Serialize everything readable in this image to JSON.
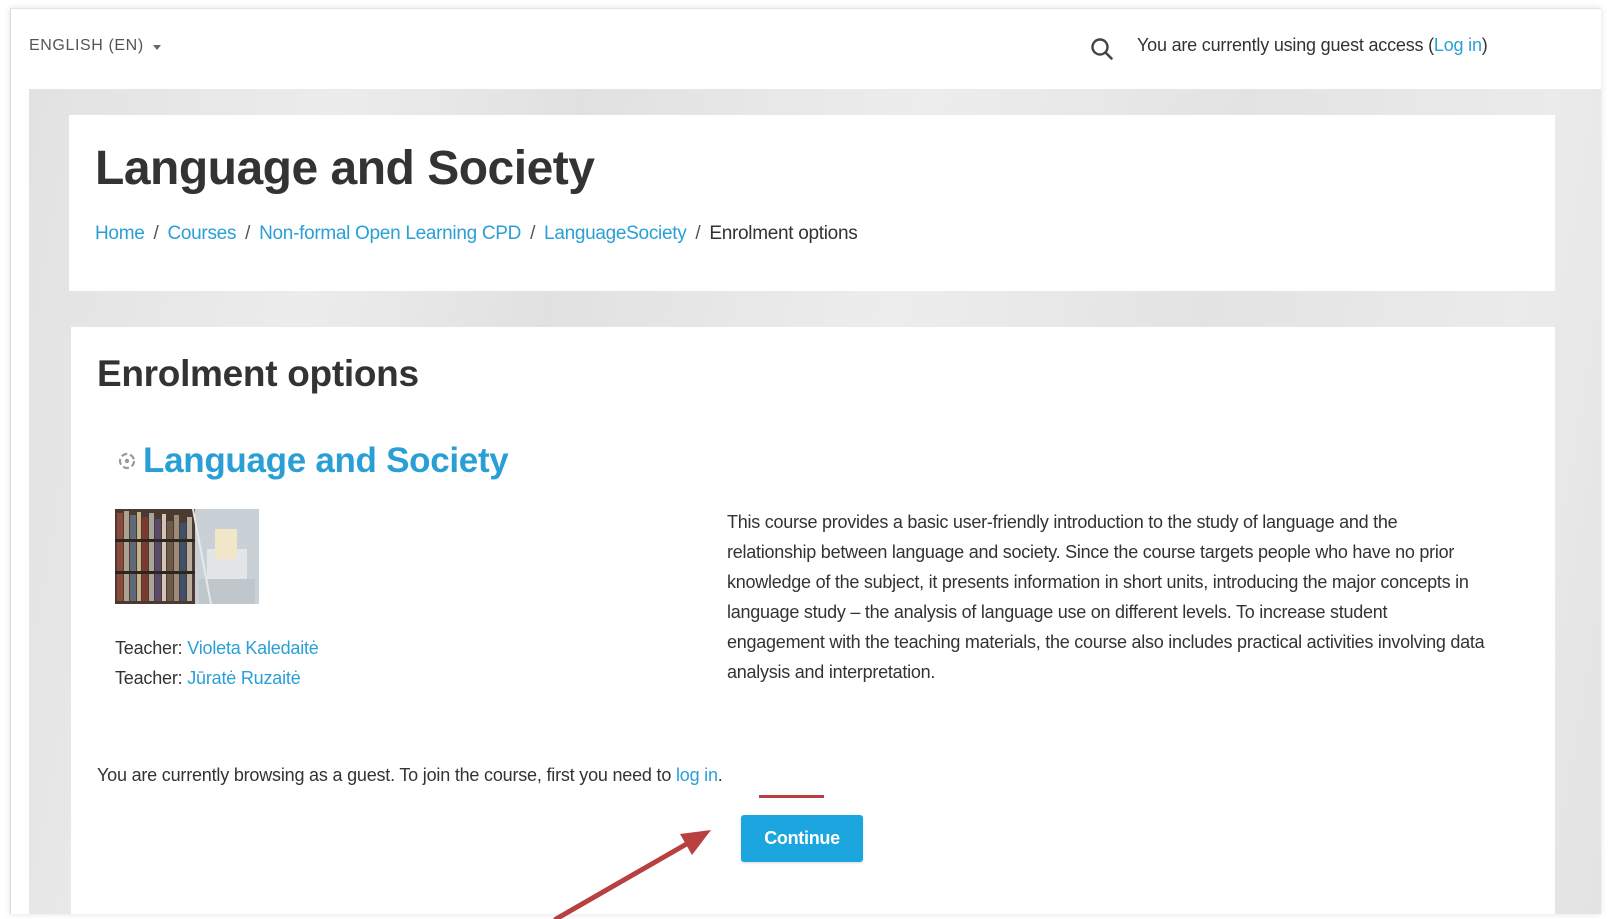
{
  "topbar": {
    "language": "ENGLISH (EN)",
    "guest_prefix": "You are currently using guest access (",
    "login_link": "Log in",
    "guest_suffix": ")"
  },
  "header": {
    "title": "Language and Society",
    "breadcrumb": [
      {
        "label": "Home"
      },
      {
        "label": "Courses"
      },
      {
        "label": "Non-formal Open Learning CPD"
      },
      {
        "label": "LanguageSociety"
      },
      {
        "label": "Enrolment options"
      }
    ],
    "separator": "/"
  },
  "main": {
    "section_title": "Enrolment options",
    "course_name": "Language and Society",
    "teachers": [
      {
        "role": "Teacher: ",
        "name": "Violeta Kaledaitė"
      },
      {
        "role": "Teacher: ",
        "name": "Jūratė Ruzaitė"
      }
    ],
    "summary": "This course provides a basic user-friendly introduction to the study of language and the relationship between language and society. Since the course targets people who have no prior knowledge of the subject, it presents information in short units, introducing the major concepts in language study – the analysis of language use on different levels. To increase student engagement with the teaching materials, the course also includes practical activities involving data analysis and interpretation.",
    "notice_prefix": "You are currently browsing as a guest. To join the course, first you need to ",
    "notice_link": "log in",
    "notice_suffix": ".",
    "continue_label": "Continue"
  },
  "colors": {
    "link": "#2a9fd6",
    "button": "#1ba6df",
    "annotation": "#b84040"
  },
  "icons": [
    "caret-down-icon",
    "search-icon",
    "course-icon",
    "annotation-arrow"
  ]
}
